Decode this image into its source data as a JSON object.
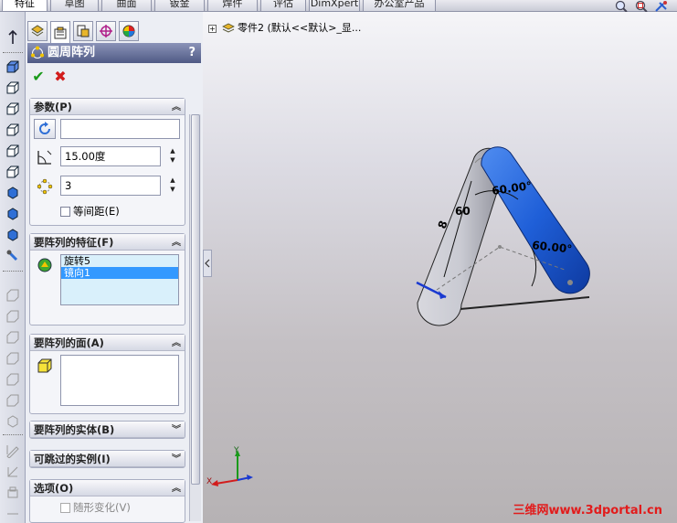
{
  "tabs": [
    {
      "label": "特征",
      "active": true
    },
    {
      "label": "草图",
      "active": false
    },
    {
      "label": "曲面",
      "active": false
    },
    {
      "label": "钣金",
      "active": false
    },
    {
      "label": "焊件",
      "active": false
    },
    {
      "label": "评估",
      "active": false
    },
    {
      "label": "DimXpert",
      "active": false
    },
    {
      "label": "办公室产品",
      "active": false
    }
  ],
  "top_icons": [
    "zoom-fit-icon",
    "zoom-area-icon",
    "view-orient-icon"
  ],
  "property_manager": {
    "title": "圆周阵列",
    "help": "?",
    "ok_label": "✔",
    "cancel_label": "✖",
    "tab_icons": [
      "feature-manager-icon",
      "property-manager-icon",
      "configuration-manager-icon",
      "dimxpert-icon",
      "display-manager-icon"
    ],
    "params": {
      "header": "参数(P)",
      "axis_value": "",
      "angle_value": "15.00度",
      "count_value": "3",
      "equal_spacing_label": "等间距(E)",
      "equal_spacing_checked": false
    },
    "features": {
      "header": "要阵列的特征(F)",
      "items": [
        "旋转5",
        "镜向1"
      ],
      "selected_index": 1
    },
    "faces": {
      "header": "要阵列的面(A)"
    },
    "bodies": {
      "header": "要阵列的实体(B)"
    },
    "skip": {
      "header": "可跳过的实例(I)"
    },
    "options": {
      "header": "选项(O)",
      "geometry_label": "随形变化(V)"
    }
  },
  "viewport": {
    "breadcrumb": "零件2 (默认<<默认>_显...",
    "dims": {
      "d1": "60.00°",
      "d2": "60.00°",
      "d3": "60",
      "d4": "8"
    },
    "triad": {
      "x": "X",
      "y": "Y"
    },
    "watermark": "三维网www.3dportal.cn"
  },
  "colors": {
    "accent": "#3366dd",
    "selected": "#3399ff",
    "title_bar": "#5a6590"
  }
}
